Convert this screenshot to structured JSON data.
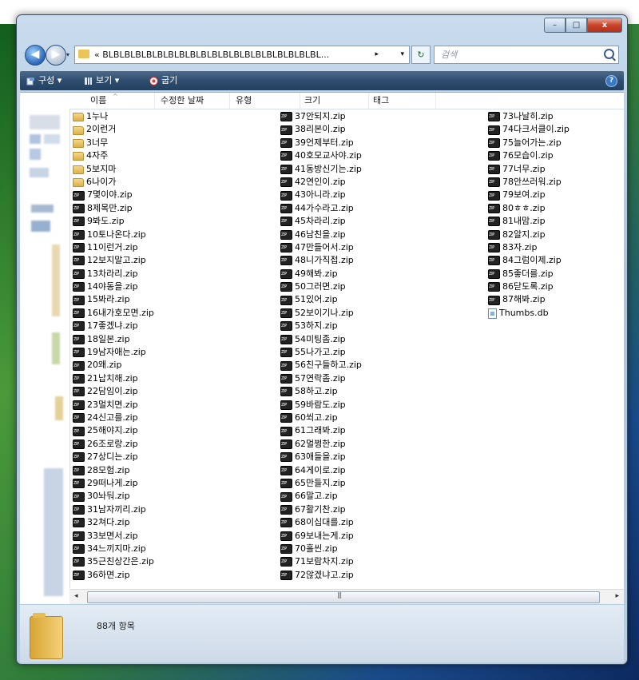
{
  "window": {
    "caption_buttons": {
      "minimize": "–",
      "maximize": "□",
      "close": "x"
    }
  },
  "address_bar": {
    "back_glyph": "◀",
    "forward_glyph": "▶",
    "path_text": "« BLBLBLBLBLBLBLBLBLBLBLBLBLBLBLBLBLBLBLBL...",
    "path_arrow": "▸",
    "dropdown_glyph": "▾",
    "refresh_glyph": "↻",
    "search_placeholder": "검색"
  },
  "toolbar": {
    "organize": "구성 ▾",
    "view": "보기 ▾",
    "burn": "굽기",
    "help": "?"
  },
  "columns": {
    "name": "이름",
    "modified": "수정한 날짜",
    "type": "유형",
    "size": "크기",
    "tags": "태그",
    "sort_glyph": "^"
  },
  "files": {
    "col1": [
      {
        "icon": "folder",
        "name": "1누나"
      },
      {
        "icon": "folder",
        "name": "2이런거"
      },
      {
        "icon": "folder",
        "name": "3너무"
      },
      {
        "icon": "folder",
        "name": "4자주"
      },
      {
        "icon": "folder",
        "name": "5보지마"
      },
      {
        "icon": "folder",
        "name": "6나이가"
      },
      {
        "icon": "zip",
        "name": "7몇이야.zip"
      },
      {
        "icon": "zip",
        "name": "8제목만.zip"
      },
      {
        "icon": "zip",
        "name": "9봐도.zip"
      },
      {
        "icon": "zip",
        "name": "10토나온다.zip"
      },
      {
        "icon": "zip",
        "name": "11이런거.zip"
      },
      {
        "icon": "zip",
        "name": "12보지말고.zip"
      },
      {
        "icon": "zip",
        "name": "13차라리.zip"
      },
      {
        "icon": "zip",
        "name": "14야동을.zip"
      },
      {
        "icon": "zip",
        "name": "15봐라.zip"
      },
      {
        "icon": "zip",
        "name": "16내가호모면.zip"
      },
      {
        "icon": "zip",
        "name": "17좋겠냐.zip"
      },
      {
        "icon": "zip",
        "name": "18일본.zip"
      },
      {
        "icon": "zip",
        "name": "19남자애는.zip"
      },
      {
        "icon": "zip",
        "name": "20왜.zip"
      },
      {
        "icon": "zip",
        "name": "21납치해.zip"
      },
      {
        "icon": "zip",
        "name": "22담임이.zip"
      },
      {
        "icon": "zip",
        "name": "23멀치면.zip"
      },
      {
        "icon": "zip",
        "name": "24신고를.zip"
      },
      {
        "icon": "zip",
        "name": "25해야지.zip"
      },
      {
        "icon": "zip",
        "name": "26조로랑.zip"
      },
      {
        "icon": "zip",
        "name": "27상디는.zip"
      },
      {
        "icon": "zip",
        "name": "28모험.zip"
      },
      {
        "icon": "zip",
        "name": "29떠나게.zip"
      },
      {
        "icon": "zip",
        "name": "30놔둬.zip"
      },
      {
        "icon": "zip",
        "name": "31남자끼리.zip"
      },
      {
        "icon": "zip",
        "name": "32쳐다.zip"
      },
      {
        "icon": "zip",
        "name": "33보면서.zip"
      },
      {
        "icon": "zip",
        "name": "34느끼지마.zip"
      },
      {
        "icon": "zip",
        "name": "35근친상간은.zip"
      },
      {
        "icon": "zip",
        "name": "36하면.zip"
      }
    ],
    "col2": [
      {
        "icon": "zip",
        "name": "37안되지.zip"
      },
      {
        "icon": "zip",
        "name": "38리본이.zip"
      },
      {
        "icon": "zip",
        "name": "39언제부터.zip"
      },
      {
        "icon": "zip",
        "name": "40호모교사야.zip"
      },
      {
        "icon": "zip",
        "name": "41동방신기는.zip"
      },
      {
        "icon": "zip",
        "name": "42연인이.zip"
      },
      {
        "icon": "zip",
        "name": "43아니라.zip"
      },
      {
        "icon": "zip",
        "name": "44가수라고.zip"
      },
      {
        "icon": "zip",
        "name": "45차라리.zip"
      },
      {
        "icon": "zip",
        "name": "46남친을.zip"
      },
      {
        "icon": "zip",
        "name": "47만들어서.zip"
      },
      {
        "icon": "zip",
        "name": "48니가직접.zip"
      },
      {
        "icon": "zip",
        "name": "49해봐.zip"
      },
      {
        "icon": "zip",
        "name": "50그러면.zip"
      },
      {
        "icon": "zip",
        "name": "51있어.zip"
      },
      {
        "icon": "zip",
        "name": "52보이기나.zip"
      },
      {
        "icon": "zip",
        "name": "53하지.zip"
      },
      {
        "icon": "zip",
        "name": "54미팅좀.zip"
      },
      {
        "icon": "zip",
        "name": "55나가고.zip"
      },
      {
        "icon": "zip",
        "name": "56친구들하고.zip"
      },
      {
        "icon": "zip",
        "name": "57연락좀.zip"
      },
      {
        "icon": "zip",
        "name": "58하고.zip"
      },
      {
        "icon": "zip",
        "name": "59바람도.zip"
      },
      {
        "icon": "zip",
        "name": "60쐬고.zip"
      },
      {
        "icon": "zip",
        "name": "61그래봐.zip"
      },
      {
        "icon": "zip",
        "name": "62멀쩡한.zip"
      },
      {
        "icon": "zip",
        "name": "63애들을.zip"
      },
      {
        "icon": "zip",
        "name": "64게이로.zip"
      },
      {
        "icon": "zip",
        "name": "65만들지.zip"
      },
      {
        "icon": "zip",
        "name": "66말고.zip"
      },
      {
        "icon": "zip",
        "name": "67활기찬.zip"
      },
      {
        "icon": "zip",
        "name": "68이십대를.zip"
      },
      {
        "icon": "zip",
        "name": "69보내는게.zip"
      },
      {
        "icon": "zip",
        "name": "70홀씬.zip"
      },
      {
        "icon": "zip",
        "name": "71보람차지.zip"
      },
      {
        "icon": "zip",
        "name": "72않겠냐고.zip"
      }
    ],
    "col3": [
      {
        "icon": "zip",
        "name": "73나날히.zip"
      },
      {
        "icon": "zip",
        "name": "74다크서클이.zip"
      },
      {
        "icon": "zip",
        "name": "75늘어가는.zip"
      },
      {
        "icon": "zip",
        "name": "76모습이.zip"
      },
      {
        "icon": "zip",
        "name": "77너무.zip"
      },
      {
        "icon": "zip",
        "name": "78안쓰러워.zip"
      },
      {
        "icon": "zip",
        "name": "79보여.zip"
      },
      {
        "icon": "zip",
        "name": "80ㅎㅎ.zip"
      },
      {
        "icon": "zip",
        "name": "81내맘.zip"
      },
      {
        "icon": "zip",
        "name": "82알지.zip"
      },
      {
        "icon": "zip",
        "name": "83자.zip"
      },
      {
        "icon": "zip",
        "name": "84그럼이제.zip"
      },
      {
        "icon": "zip",
        "name": "85좋더를.zip"
      },
      {
        "icon": "zip",
        "name": "86닫도록.zip"
      },
      {
        "icon": "zip",
        "name": "87해봐.zip"
      },
      {
        "icon": "db",
        "name": "Thumbs.db"
      }
    ]
  },
  "scrollbar": {
    "left": "◂",
    "right": "▸",
    "grip": "|||"
  },
  "details": {
    "item_count": "88개 항목"
  },
  "colors": {
    "toolbar": "#2f4d6f",
    "selection": "#3a78c8"
  }
}
